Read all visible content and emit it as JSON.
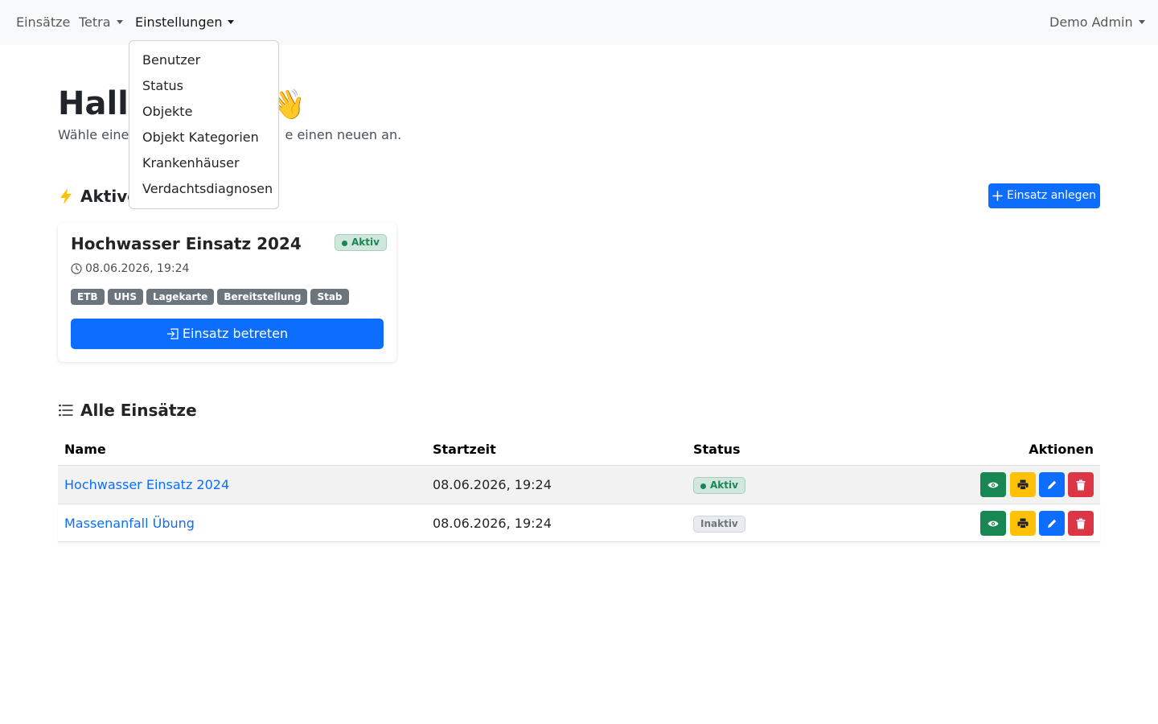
{
  "navbar": {
    "items": [
      {
        "label": "Einsätze"
      },
      {
        "label": "Tetra"
      },
      {
        "label": "Einstellungen"
      }
    ],
    "user_label": "Demo Admin"
  },
  "dropdown": {
    "items": [
      "Benutzer",
      "Status",
      "Objekte",
      "Objekt Kategorien",
      "Krankenhäuser",
      "Verdachtsdiagnosen"
    ]
  },
  "page": {
    "greeting_visible": "Hallo",
    "greeting_emoji": "👋",
    "subtitle_visible_left": "Wähle einen",
    "subtitle_visible_right": "e einen neuen an."
  },
  "active_section": {
    "title_visible": "Aktive",
    "create_button": "Einsatz anlegen"
  },
  "active_card": {
    "title": "Hochwasser Einsatz 2024",
    "status": "Aktiv",
    "date": "08.06.2026, 19:24",
    "tags": [
      "ETB",
      "UHS",
      "Lagekarte",
      "Bereitstellung",
      "Stab"
    ],
    "enter_button": "Einsatz betreten"
  },
  "all_section": {
    "title": "Alle Einsätze"
  },
  "table": {
    "headers": {
      "name": "Name",
      "start": "Startzeit",
      "status": "Status",
      "actions": "Aktionen"
    },
    "rows": [
      {
        "name": "Hochwasser Einsatz 2024",
        "start": "08.06.2026, 19:24",
        "status": "Aktiv"
      },
      {
        "name": "Massenanfall Übung",
        "start": "08.06.2026, 19:24",
        "status": "Inaktiv"
      }
    ]
  },
  "colors": {
    "primary": "#0d6efd",
    "success": "#198754",
    "warning": "#ffc107",
    "danger": "#dc3545",
    "secondary": "#6c757d"
  }
}
